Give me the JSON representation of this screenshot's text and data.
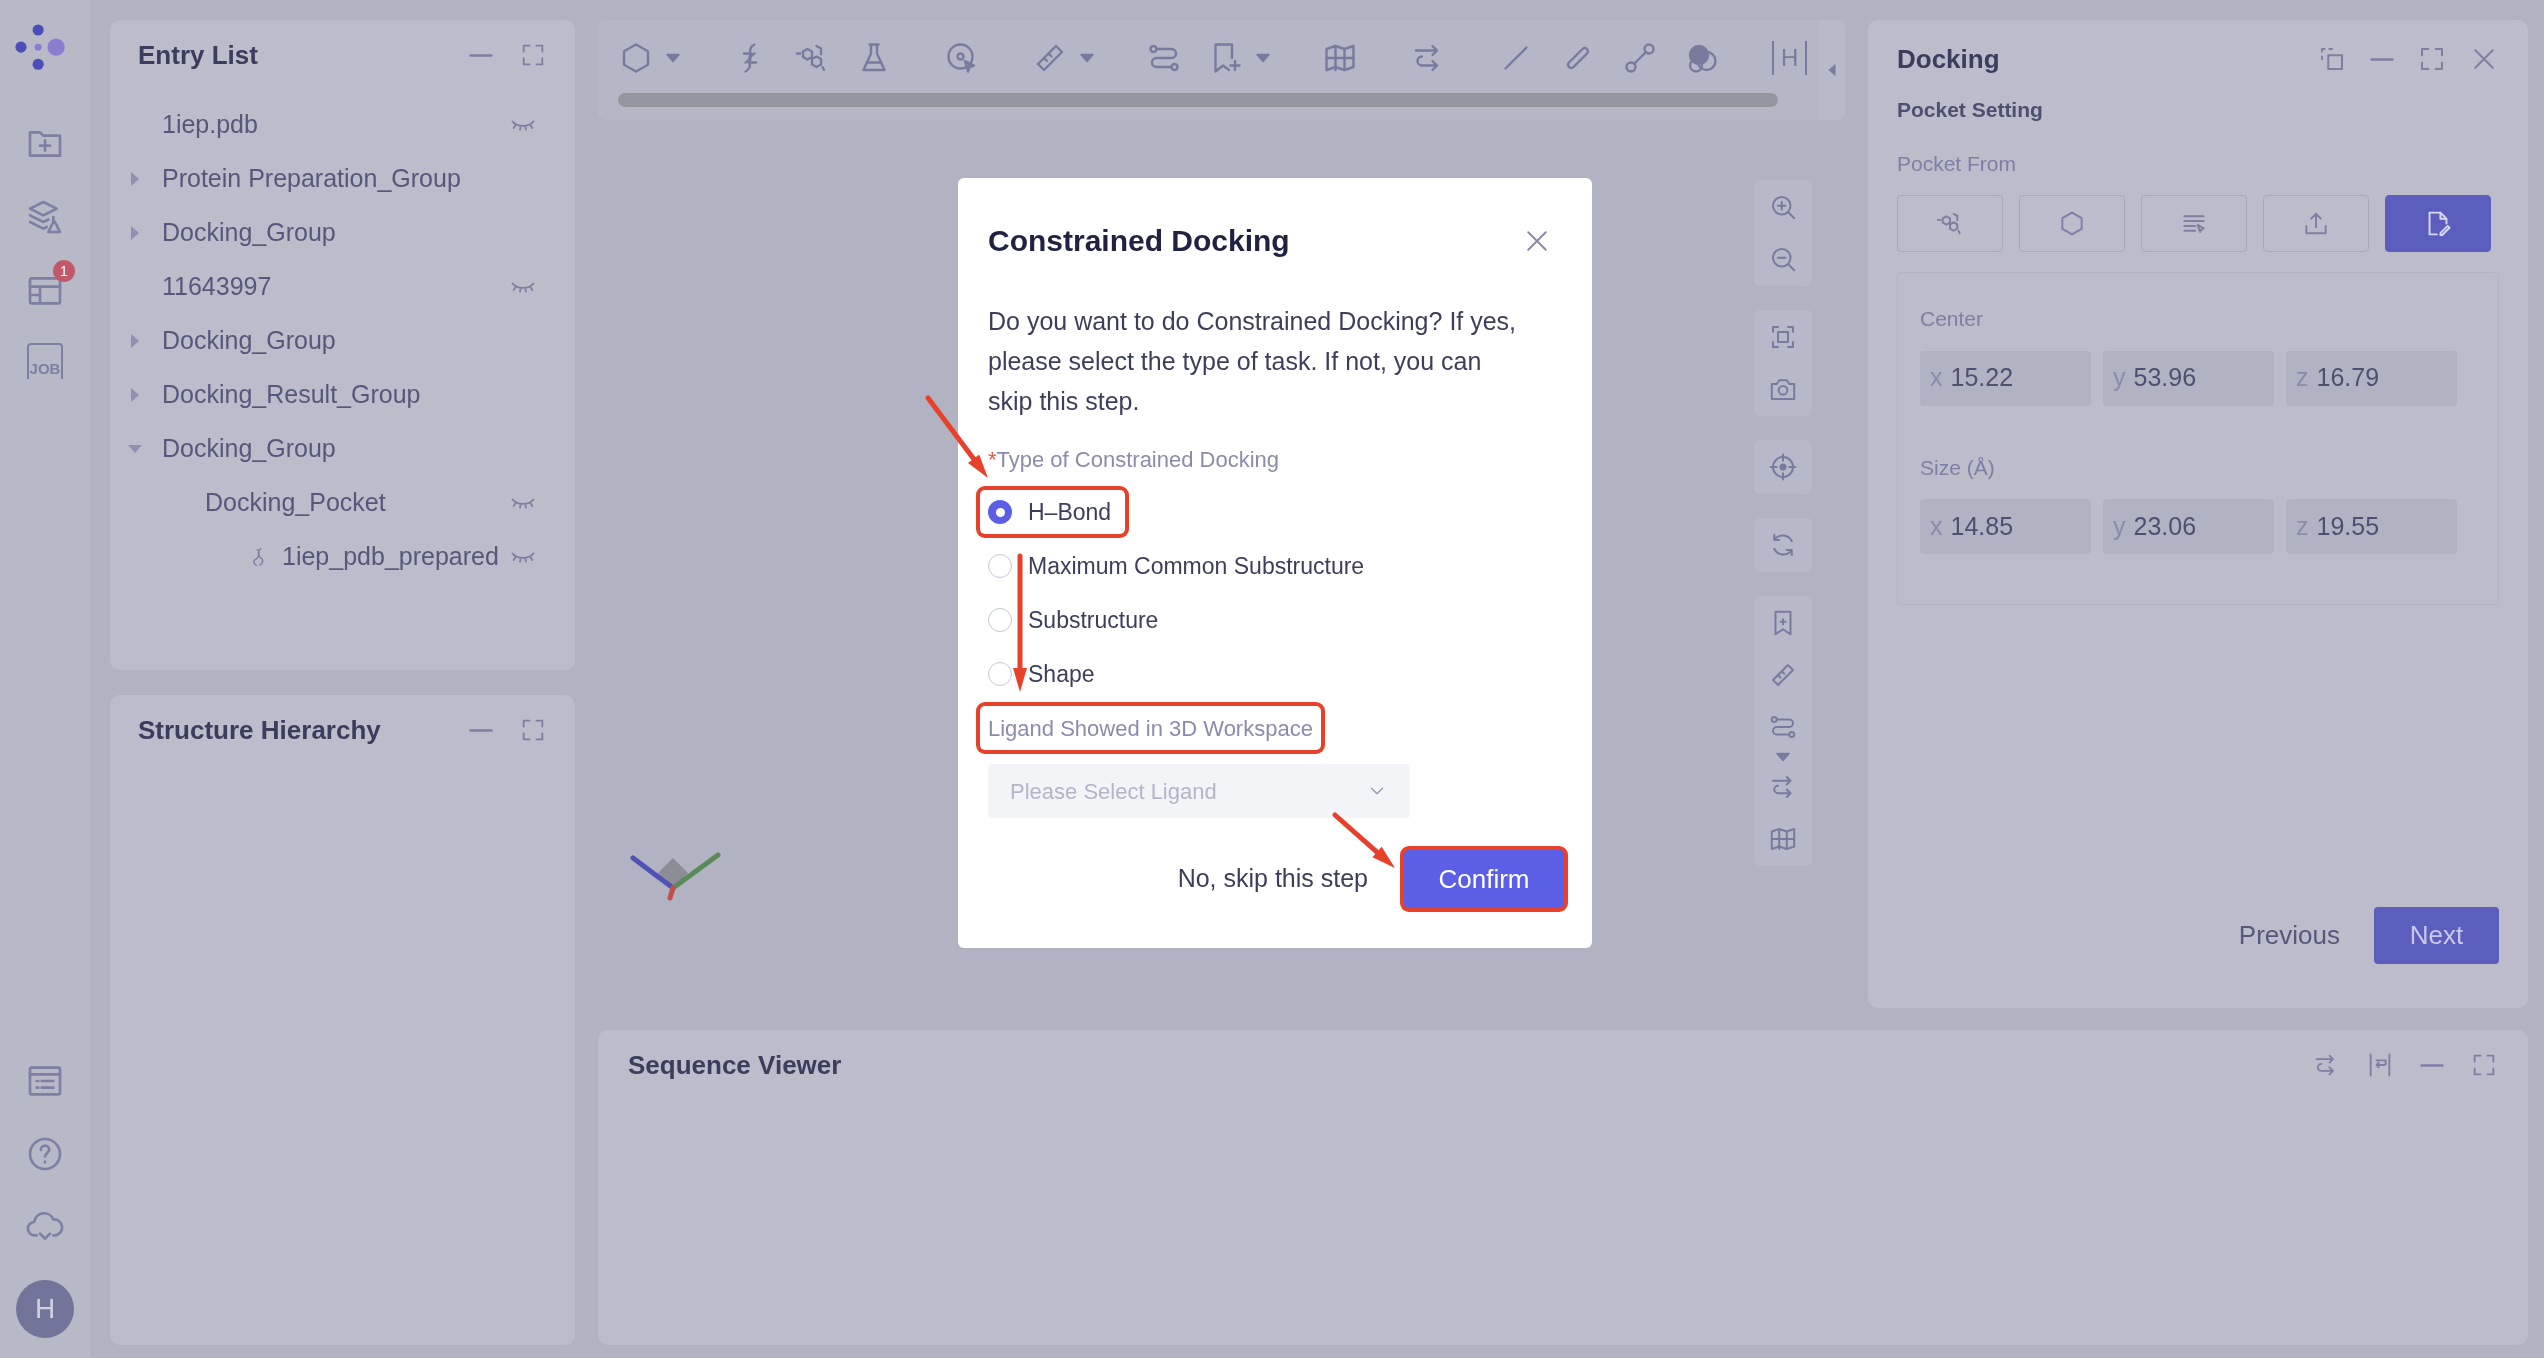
{
  "rail": {
    "top_items": [
      {
        "kind": "folder-plus"
      },
      {
        "kind": "layers-flask"
      },
      {
        "kind": "table",
        "badge": "1"
      },
      {
        "kind": "job",
        "label": "JOB"
      }
    ],
    "bottom_items": [
      {
        "kind": "list-doc"
      },
      {
        "kind": "help"
      },
      {
        "kind": "cloud-check"
      }
    ],
    "avatar": "H"
  },
  "entry_list": {
    "title": "Entry List",
    "items": [
      {
        "label": "1iep.pdb",
        "kind": "entry",
        "visible": false
      },
      {
        "label": "Protein Preparation_Group",
        "kind": "group",
        "expanded": false
      },
      {
        "label": "Docking_Group",
        "kind": "group",
        "expanded": false
      },
      {
        "label": "11643997",
        "kind": "entry",
        "visible": false
      },
      {
        "label": "Docking_Group",
        "kind": "group",
        "expanded": false
      },
      {
        "label": "Docking_Result_Group",
        "kind": "group",
        "expanded": false
      },
      {
        "label": "Docking_Group",
        "kind": "group",
        "expanded": true,
        "children": [
          {
            "label": "Docking_Pocket",
            "kind": "entry",
            "visible": false,
            "children": [
              {
                "label": "1iep_pdb_prepared",
                "kind": "protein",
                "visible": false
              }
            ]
          }
        ]
      }
    ]
  },
  "structure_hierarchy": {
    "title": "Structure Hierarchy"
  },
  "toolbar": {
    "hydrogen_label": "H"
  },
  "docking": {
    "title": "Docking",
    "section": "Pocket Setting",
    "pocket_from_label": "Pocket From",
    "pocket_sources": [
      {
        "kind": "rings",
        "selected": false
      },
      {
        "kind": "hexagon",
        "selected": false
      },
      {
        "kind": "list",
        "selected": false
      },
      {
        "kind": "upload",
        "selected": false
      },
      {
        "kind": "file-edit",
        "selected": true
      }
    ],
    "center_label": "Center",
    "center": [
      {
        "axis": "x",
        "value": "15.22"
      },
      {
        "axis": "y",
        "value": "53.96"
      },
      {
        "axis": "z",
        "value": "16.79"
      }
    ],
    "size_label": "Size (Å)",
    "size": [
      {
        "axis": "x",
        "value": "14.85"
      },
      {
        "axis": "y",
        "value": "23.06"
      },
      {
        "axis": "z",
        "value": "19.55"
      }
    ],
    "previous": "Previous",
    "next": "Next"
  },
  "sequence_viewer": {
    "title": "Sequence Viewer"
  },
  "modal": {
    "title": "Constrained Docking",
    "message": "Do you want to do Constrained Docking? If yes, please select the type of task. If not, you can skip this step.",
    "type_label": "Type of Constrained Docking",
    "required_mark": "*",
    "options": [
      {
        "label": "H–Bond",
        "selected": true,
        "highlighted": true
      },
      {
        "label": "Maximum Common Substructure",
        "selected": false,
        "highlighted": false
      },
      {
        "label": "Substructure",
        "selected": false,
        "highlighted": false
      },
      {
        "label": "Shape",
        "selected": false,
        "highlighted": false
      }
    ],
    "ligand_label": "Ligand Showed in 3D Workspace",
    "ligand_highlighted": true,
    "ligand_select": {
      "placeholder": "Please Select Ligand"
    },
    "skip": "No, skip this step",
    "confirm": "Confirm",
    "confirm_highlighted": true
  }
}
